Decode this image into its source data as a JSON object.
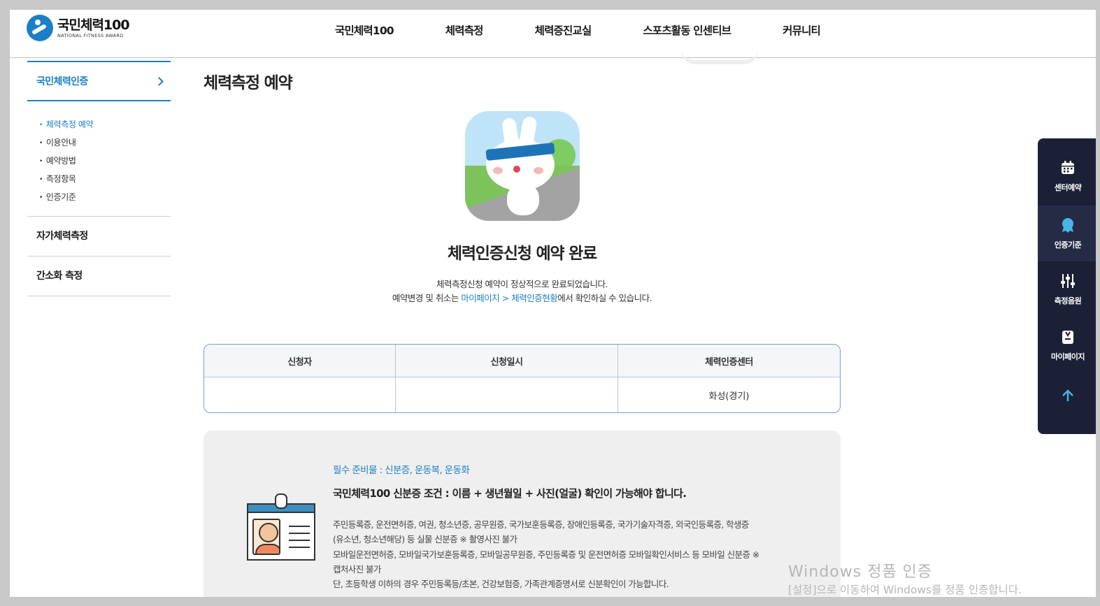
{
  "logo": {
    "title": "국민체력100",
    "subtitle": "NATIONAL FITNESS AWARD"
  },
  "gnb": [
    "국민체력100",
    "체력측정",
    "체력증진교실",
    "스포츠활동 인센티브",
    "커뮤니티"
  ],
  "lnb": {
    "section": "국민체력인증",
    "sub_items": [
      "체력측정 예약",
      "이용안내",
      "예약방법",
      "측정항목",
      "인증기준"
    ],
    "items": [
      "자가체력측정",
      "간소화 측정"
    ]
  },
  "main": {
    "page_title": "체력측정 예약",
    "done_title": "체력인증신청 예약 완료",
    "msg1": "체력측정신청 예약이 정상적으로 완료되었습니다.",
    "msg2_pre": "예약변경 및 취소는 ",
    "msg2_link": "마이페이지 > 체력인증현황",
    "msg2_post": "에서 확인하실 수 있습니다.",
    "table": {
      "headers": [
        "신청자",
        "신청일시",
        "체력인증센터"
      ],
      "row": [
        "",
        "",
        "화성(경기)"
      ]
    },
    "info": {
      "required": "필수 준비물 : 신분증, 운동복, 운동화",
      "condition": "국민체력100 신분증 조건 : 이름 + 생년월일 + 사진(얼굴) 확인이 가능해야 합니다.",
      "desc_lines": [
        "주민등록증, 운전면허증, 여권, 청소년증, 공무원증, 국가보훈등록증, 장애인등록증, 국가기술자격증, 외국인등록증, 학생증",
        "(유소년, 청소년해당) 등 실물 신분증 ※ 촬영사진 불가",
        "모바일운전면허증, 모바일국가보훈등록증, 모바일공무원증, 주민등록증 및 운전면허증 모바일확인서비스 등 모바일 신분증 ※",
        "캡처사진 불가",
        "단, 초등학생 이하의 경우 주민등록등/초본, 건강보험증, 가족관계증명서로 신분확인이 가능합니다."
      ]
    }
  },
  "quick_menu": [
    {
      "label": "센터예약",
      "icon": "calendar-icon"
    },
    {
      "label": "인증기준",
      "icon": "badge-icon"
    },
    {
      "label": "측정음원",
      "icon": "sliders-icon"
    },
    {
      "label": "마이페이지",
      "icon": "clipboard-icon"
    }
  ],
  "watermark": {
    "line1": "Windows 정품 인증",
    "line2": "[설정]으로 이동하여 Windows를 정품 인증합니다."
  },
  "colors": {
    "accent": "#1a7fc6",
    "quick_bg": "#1b2036",
    "table_border": "#7d97d6"
  }
}
